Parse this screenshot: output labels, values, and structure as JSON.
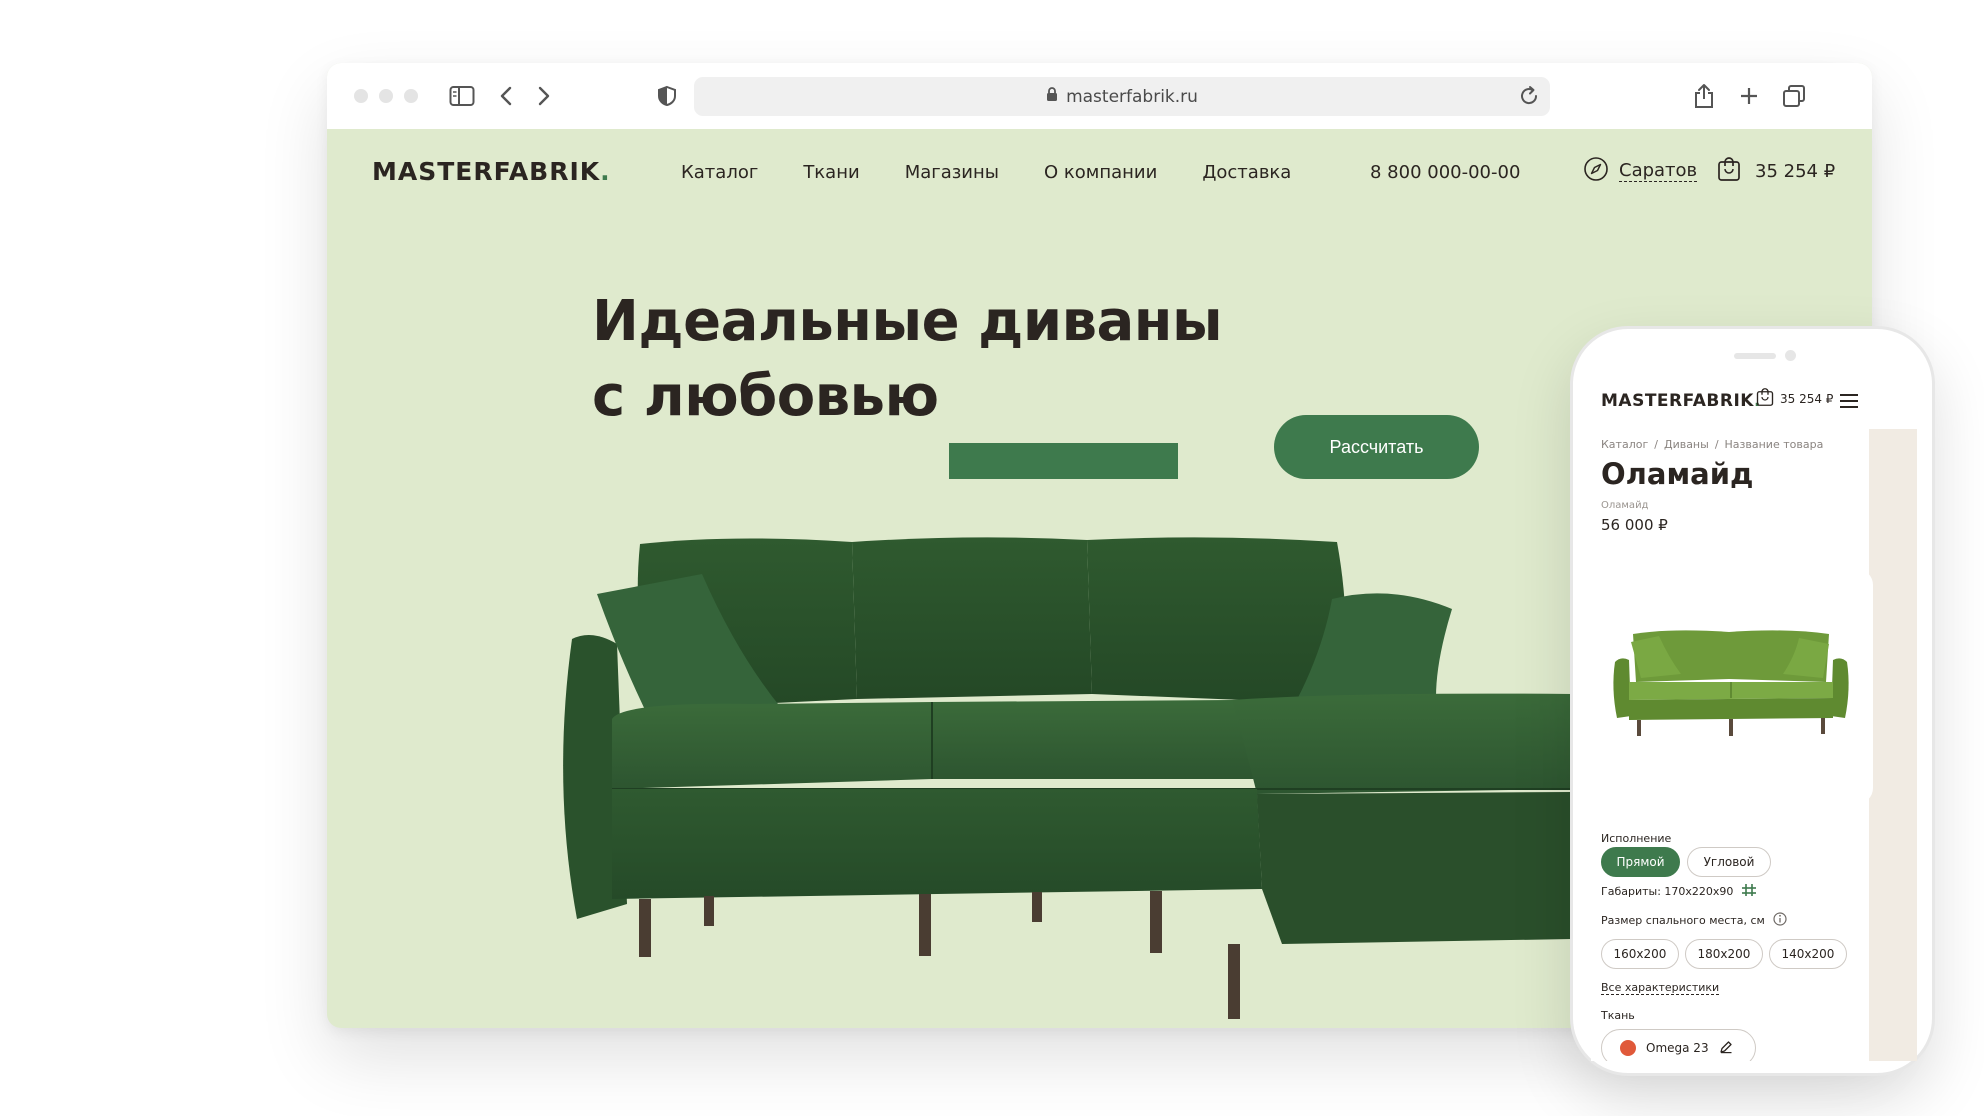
{
  "browser": {
    "url": "masterfabrik.ru"
  },
  "site": {
    "logo_text": "MASTERFABRIK",
    "logo_dot": ".",
    "nav": [
      "Каталог",
      "Ткани",
      "Магазины",
      "О компании",
      "Доставка"
    ],
    "phone": "8 800 000-00-00",
    "city": "Саратов",
    "cart_total": "35 254 ₽",
    "hero_line1": "Идеальные диваны",
    "hero_line2": "с любовью",
    "cta_label": "Рассчитать"
  },
  "mobile": {
    "logo_text": "MASTERFABRIK",
    "logo_dot": ".",
    "cart_total": "35 254 ₽",
    "breadcrumb": [
      "Каталог",
      "/",
      "Диваны",
      "/",
      "Название товара"
    ],
    "title": "Оламайд",
    "subtitle": "Оламайд",
    "price": "56 000 ₽",
    "execution_label": "Исполнение",
    "execution_options": [
      "Прямой",
      "Угловой"
    ],
    "dims_label": "Габариты: 170х220х90",
    "sleep_label": "Размер спального места, см",
    "sleep_options": [
      "160х200",
      "180х200",
      "140х200"
    ],
    "all_specs": "Все характеристики",
    "fabric_label": "Ткань",
    "fabric_value": "Omega 23"
  },
  "colors": {
    "accent": "#3e7a4d",
    "hero_bg": "#dfeacd",
    "text": "#2b2521",
    "fabric_swatch": "#e0593a"
  }
}
